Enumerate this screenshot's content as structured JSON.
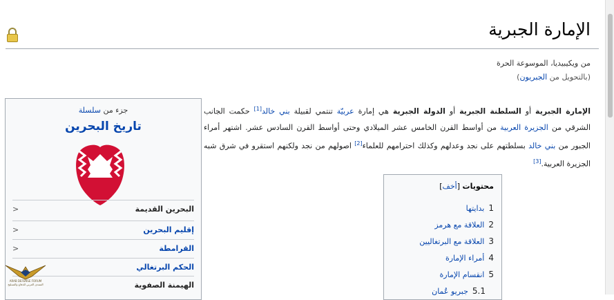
{
  "page": {
    "title": "الإمارة الجبرية",
    "site_sub": "من ويكيبيديا، الموسوعة الحرة",
    "redirect_open": "(بالتحويل من ",
    "redirect_link": "الجبريون",
    "redirect_close": ")"
  },
  "lead": {
    "s1": "الإمارة الجبرية",
    "s2": " أو ",
    "s3": "السلطنة الجبرية",
    "s4": " أو ",
    "s5": "الدولة الجبرية",
    "s6": " هي إمارة ",
    "s7": "عربيّة",
    "s8": " تنتمي لقبيلة ",
    "s9": "بني خالد",
    "s10": "[1]",
    "s11": " حكمت الجانب الشرقي من ",
    "s12": "الجزيرة العربية",
    "s13": " من أواسط القرن الخامس عشر الميلادي وحتى أواسط القرن السادس عشر. اشتهر أمراء الجبور من ",
    "s14": "بني خالد",
    "s15": " بسلطتهم على نجد وعدلهم وكذلك احترامهم للعلماء",
    "s16": "[2]",
    "s17": " اصولهم من نجد ولكنهم استقرو في شرق شبه الجزيرة العربية.",
    "s18": "[3]"
  },
  "toc": {
    "title": "محتويات",
    "toggle_open": " [",
    "toggle": "أخف",
    "toggle_close": "]",
    "items": [
      {
        "num": "1",
        "label": "بدايتها"
      },
      {
        "num": "2",
        "label": "العلاقة مع هرمز"
      },
      {
        "num": "3",
        "label": "العلاقة مع البرتغاليين"
      },
      {
        "num": "4",
        "label": "أمراء الإمارة"
      },
      {
        "num": "5",
        "label": "انقسام الإمارة"
      },
      {
        "num": "5.1",
        "label": "جبريو عُمان"
      }
    ]
  },
  "infobox": {
    "above_text": "جزء من ",
    "above_link": "سلسلة",
    "title": "تاريخ البحرين",
    "rows": [
      {
        "label": "البحرين القديمة",
        "arrow": "<"
      },
      {
        "label": "إقليم البحرين",
        "arrow": "<"
      },
      {
        "label": "القرامطة",
        "arrow": "<"
      },
      {
        "label": "الحكم البرتغالي",
        "arrow": ""
      },
      {
        "label": "الهيمنة الصفوية",
        "arrow": ""
      }
    ]
  },
  "watermark": {
    "line1": "ARAB DEFENSE FORUM",
    "line2": "المنتدى العربي للدفاع والتسليح"
  },
  "colors": {
    "link": "#0645ad",
    "border": "#a2a9b1",
    "box_bg": "#f8f9fa",
    "emblem_red": "#d21034"
  }
}
